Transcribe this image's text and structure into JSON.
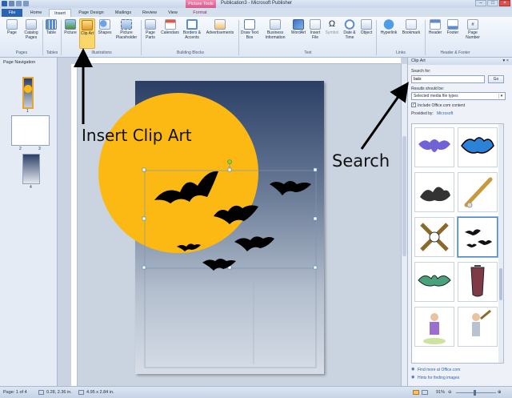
{
  "window": {
    "title": "Publication3 - Microsoft Publisher",
    "context_header": "Picture Tools"
  },
  "tabs": [
    "File",
    "Home",
    "Insert",
    "Page Design",
    "Mailings",
    "Review",
    "View",
    "Format"
  ],
  "ribbon": {
    "buttons": {
      "page": "Page",
      "catalog_pages": "Catalog Pages",
      "table": "Table",
      "picture": "Picture",
      "clip_art": "Clip Art",
      "shapes": "Shapes",
      "picture_placeholder": "Picture Placeholder",
      "page_parts": "Page Parts",
      "calendars": "Calendars",
      "borders_accents": "Borders & Accents",
      "advertisements": "Advertisements",
      "draw_text_box": "Draw Text Box",
      "business_information": "Business Information",
      "wordart": "WordArt",
      "insert_file": "Insert File",
      "symbol": "Symbol",
      "date_time": "Date & Time",
      "object": "Object",
      "hyperlink": "Hyperlink",
      "bookmark": "Bookmark",
      "header": "Header",
      "footer": "Footer",
      "page_number": "Page Number"
    },
    "groups": {
      "pages": "Pages",
      "tables": "Tables",
      "illustrations": "Illustrations",
      "building_blocks": "Building Blocks",
      "text": "Text",
      "links": "Links",
      "header_footer": "Header & Footer"
    }
  },
  "nav_pane": {
    "title": "Page Navigation",
    "pages": [
      "1",
      "2",
      "3",
      "4"
    ]
  },
  "task_pane": {
    "title": "Clip Art",
    "search_label": "Search for:",
    "search_value": "bats",
    "go_label": "Go",
    "results_label": "Results should be:",
    "results_value": "Selected media file types",
    "include_label": "Include Office.com content",
    "include_checked": "✓",
    "provided_label": "Provided by:",
    "provided_value": "Microsoft",
    "find_more": "Find more at Office.com",
    "hints": "Hints for finding images"
  },
  "annotations": {
    "insert_clip_art": "Insert Clip Art",
    "search": "Search"
  },
  "status": {
    "page": "Page: 1 of 4",
    "position": "0.28, 2.36 in.",
    "size": "4.95 x 2.84 in.",
    "zoom": "91%"
  },
  "colors": {
    "moon": "#fdb913",
    "accent": "#2a65b5",
    "context_tab": "#d45c8c"
  }
}
